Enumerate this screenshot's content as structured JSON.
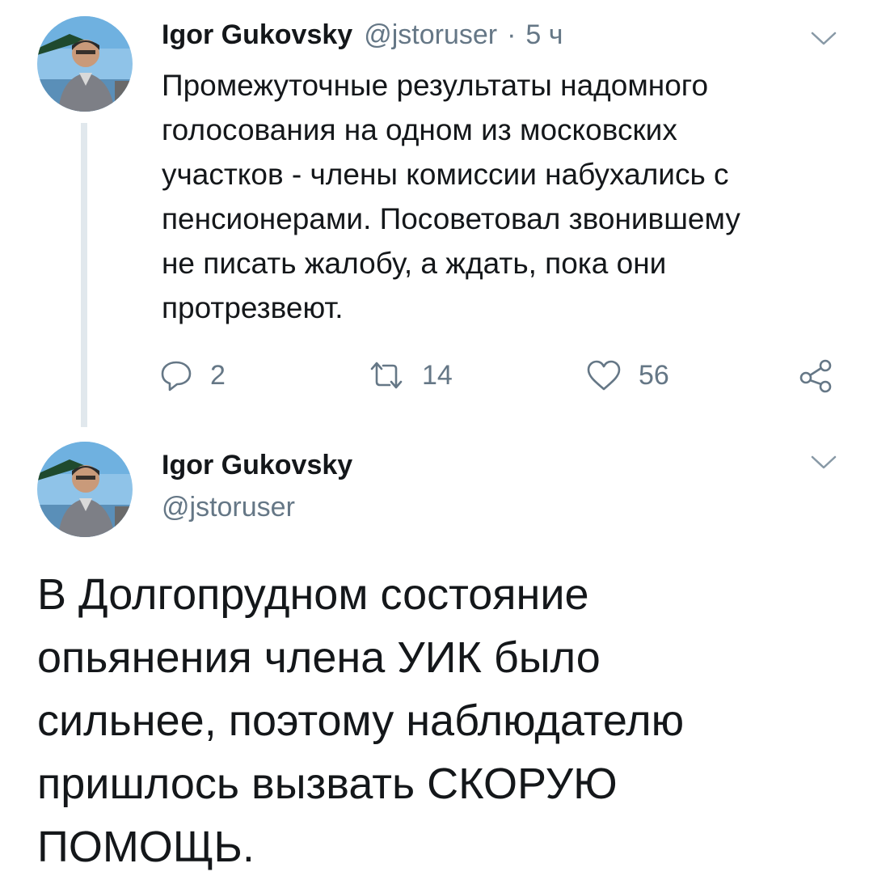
{
  "tweet1": {
    "author_name": "Igor Gukovsky",
    "handle": "@jstoruser",
    "separator": "·",
    "time": "5 ч",
    "text_lines": [
      "Промежуточные результаты надомного",
      "голосования на одном из московских",
      "участков - члены комиссии набухались с",
      "пенсионерами. Посоветовал звонившему",
      "не писать жалобу, а ждать, пока они",
      "протрезвеют."
    ],
    "replies": "2",
    "retweets": "14",
    "likes": "56",
    "icons": {
      "reply": "reply-icon",
      "retweet": "retweet-icon",
      "like": "heart-icon",
      "share": "share-icon",
      "menu": "chevron-down-icon"
    }
  },
  "tweet2": {
    "author_name": "Igor Gukovsky",
    "handle": "@jstoruser",
    "text_lines": [
      "В Долгопрудном состояние",
      "опьянения члена УИК было",
      "сильнее, поэтому наблюдателю",
      "пришлось вызвать СКОРУЮ",
      "ПОМОЩЬ."
    ]
  },
  "colors": {
    "text": "#14171a",
    "secondary": "#657786",
    "thread_line": "#e1e8ed",
    "background": "#ffffff"
  }
}
